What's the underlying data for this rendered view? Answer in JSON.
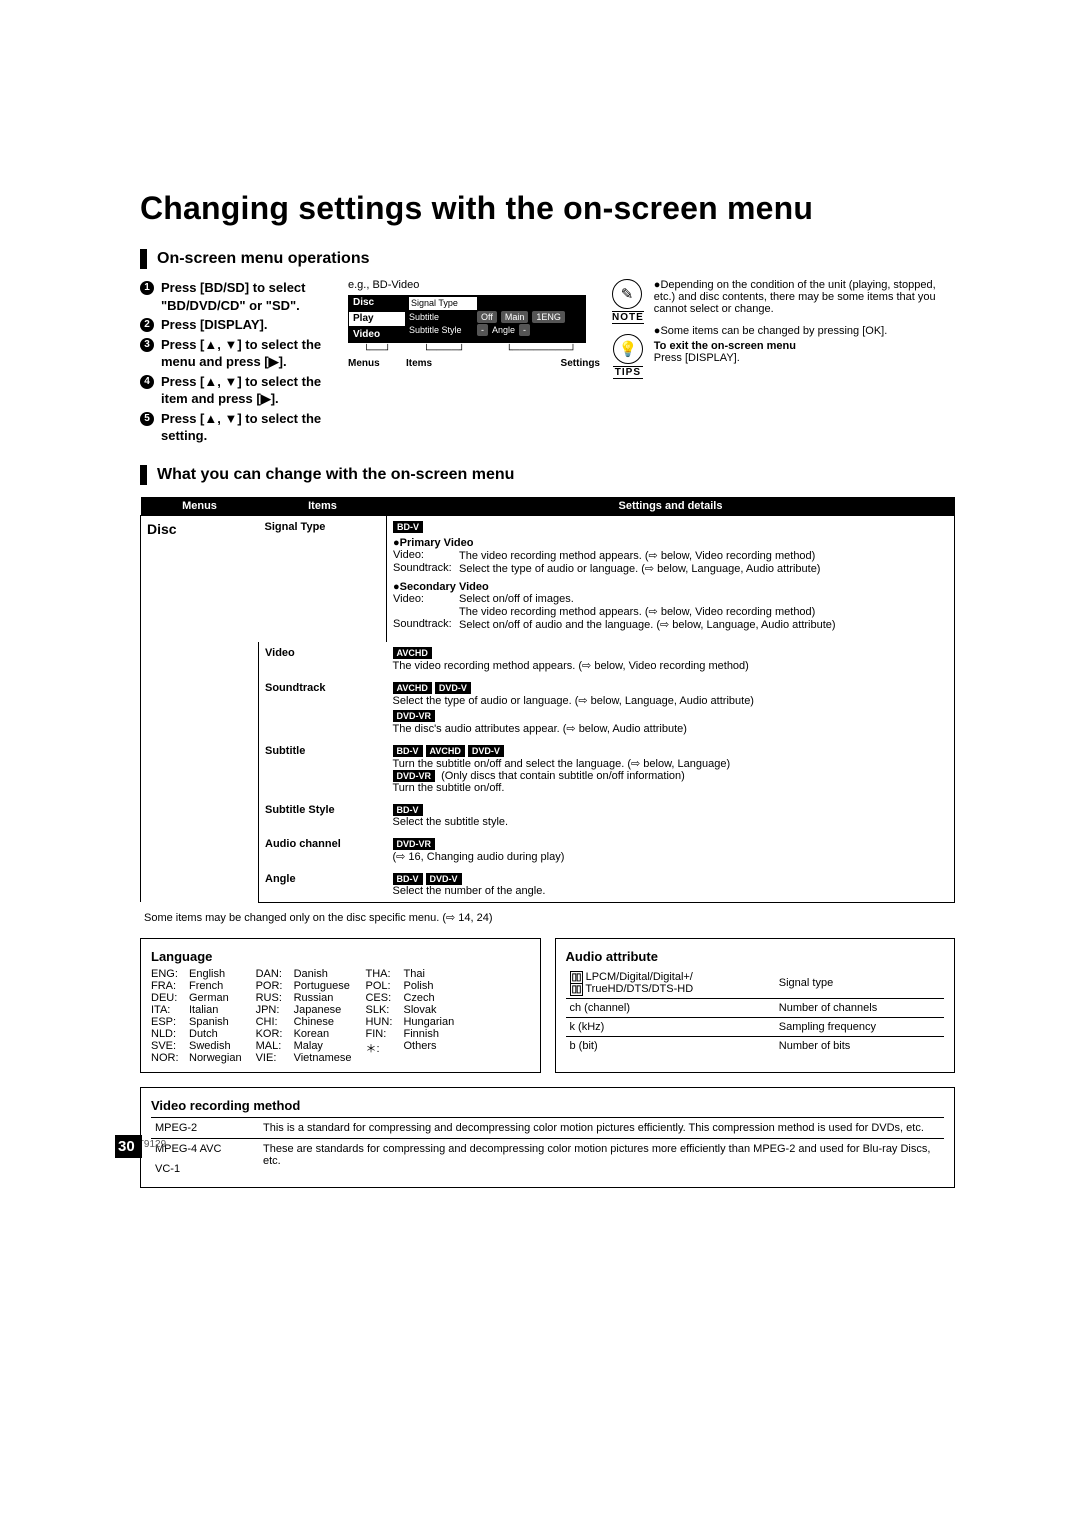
{
  "title": "Changing settings with the on-screen menu",
  "section_ops": "On-screen menu operations",
  "section_change": "What you can change with the on-screen menu",
  "steps": {
    "s1": "Press [BD/SD] to select \"BD/DVD/CD\" or \"SD\".",
    "s2": "Press [DISPLAY].",
    "s3": "Press [▲, ▼] to select the menu and press [▶].",
    "s4": "Press [▲, ▼] to select the item and press [▶].",
    "s5": "Press [▲, ▼] to select the setting."
  },
  "osd": {
    "caption": "e.g., BD-Video",
    "tabs": {
      "disc": "Disc",
      "play": "Play",
      "video": "Video"
    },
    "items": {
      "signal": "Signal Type",
      "subtitle": "Subtitle",
      "style": "Subtitle Style",
      "off": "Off",
      "main": "Main",
      "eng": "1ENG",
      "dash": "-",
      "angle": "Angle"
    },
    "labels": {
      "menus": "Menus",
      "items": "Items",
      "settings": "Settings"
    }
  },
  "note": {
    "label": "NOTE",
    "text": "Depending on the condition of the unit (playing, stopped, etc.) and disc contents, there may be some items that you cannot select or change."
  },
  "tips": {
    "label": "TIPS",
    "line1": "Some items can be changed by pressing [OK].",
    "exit_h": "To exit the on-screen menu",
    "exit_b": "Press [DISPLAY]."
  },
  "th": {
    "menus": "Menus",
    "items": "Items",
    "details": "Settings and details"
  },
  "disc_label": "Disc",
  "rows": {
    "signal": {
      "item": "Signal Type",
      "tag1": "BD-V",
      "pv_h": "Primary Video",
      "pv_video_l": "Video:",
      "pv_video_t": "The video recording method appears. (⇨ below, Video recording method)",
      "pv_sound_l": "Soundtrack:",
      "pv_sound_t": "Select the type of audio or language. (⇨ below, Language, Audio attribute)",
      "sv_h": "Secondary Video",
      "sv_video_l": "Video:",
      "sv_video_t": "Select on/off of images.",
      "sv_video_t2": "The video recording method appears. (⇨ below, Video recording method)",
      "sv_sound_l": "Soundtrack:",
      "sv_sound_t": "Select on/off of audio and the language. (⇨ below, Language, Audio attribute)"
    },
    "video": {
      "item": "Video",
      "tag": "AVCHD",
      "text": "The video recording method appears. (⇨ below, Video recording method)"
    },
    "sound": {
      "item": "Soundtrack",
      "tag1": "AVCHD",
      "tag2": "DVD-V",
      "text1": "Select the type of audio or language. (⇨ below, Language, Audio attribute)",
      "tag3": "DVD-VR",
      "text2": "The disc's audio attributes appear. (⇨ below, Audio attribute)"
    },
    "subtitle": {
      "item": "Subtitle",
      "tag1": "BD-V",
      "tag2": "AVCHD",
      "tag3": "DVD-V",
      "text1": "Turn the subtitle on/off and select the language. (⇨ below, Language)",
      "tag4": "DVD-VR",
      "text2": " (Only discs that contain subtitle on/off information)",
      "text3": "Turn the subtitle on/off."
    },
    "style": {
      "item": "Subtitle Style",
      "tag": "BD-V",
      "text": "Select the subtitle style."
    },
    "audio_ch": {
      "item": "Audio channel",
      "tag": "DVD-VR",
      "text": "(⇨ 16, Changing audio during play)"
    },
    "angle": {
      "item": "Angle",
      "tag1": "BD-V",
      "tag2": "DVD-V",
      "text": "Select the number of the angle."
    }
  },
  "footnote": "Some items may be changed only on the disc specific menu. (⇨ 14, 24)",
  "lang": {
    "title": "Language",
    "c1": [
      [
        "ENG:",
        "English"
      ],
      [
        "FRA:",
        "French"
      ],
      [
        "DEU:",
        "German"
      ],
      [
        "ITA:",
        "Italian"
      ],
      [
        "ESP:",
        "Spanish"
      ],
      [
        "NLD:",
        "Dutch"
      ],
      [
        "SVE:",
        "Swedish"
      ],
      [
        "NOR:",
        "Norwegian"
      ]
    ],
    "c2": [
      [
        "DAN:",
        "Danish"
      ],
      [
        "POR:",
        "Portuguese"
      ],
      [
        "RUS:",
        "Russian"
      ],
      [
        "JPN:",
        "Japanese"
      ],
      [
        "CHI:",
        "Chinese"
      ],
      [
        "KOR:",
        "Korean"
      ],
      [
        "MAL:",
        "Malay"
      ],
      [
        "VIE:",
        "Vietnamese"
      ]
    ],
    "c3": [
      [
        "THA:",
        "Thai"
      ],
      [
        "POL:",
        "Polish"
      ],
      [
        "CES:",
        "Czech"
      ],
      [
        "SLK:",
        "Slovak"
      ],
      [
        "HUN:",
        "Hungarian"
      ],
      [
        "FIN:",
        "Finnish"
      ],
      [
        "＊:",
        "Others"
      ]
    ]
  },
  "aud": {
    "title": "Audio attribute",
    "r1a": "LPCM/𝄞 Digital/𝄞 Digital+/",
    "r1b": "𝄞 TrueHD/DTS/DTS-HD",
    "r1v": "Signal type",
    "r2k": "ch (channel)",
    "r2v": "Number of channels",
    "r3k": "k (kHz)",
    "r3v": "Sampling frequency",
    "r4k": "b (bit)",
    "r4v": "Number of bits"
  },
  "vrm": {
    "title": "Video recording method",
    "r1k": "MPEG-2",
    "r1v": "This is a standard for compressing and decompressing color motion pictures efficiently. This compression method is used for DVDs, etc.",
    "r2k": "MPEG-4 AVC",
    "r3k": "VC-1",
    "r2v": "These are standards for compressing and decompressing color motion pictures more efficiently than MPEG-2 and used for Blu-ray Discs, etc."
  },
  "doc_id": "QT9129",
  "page_num": "30"
}
